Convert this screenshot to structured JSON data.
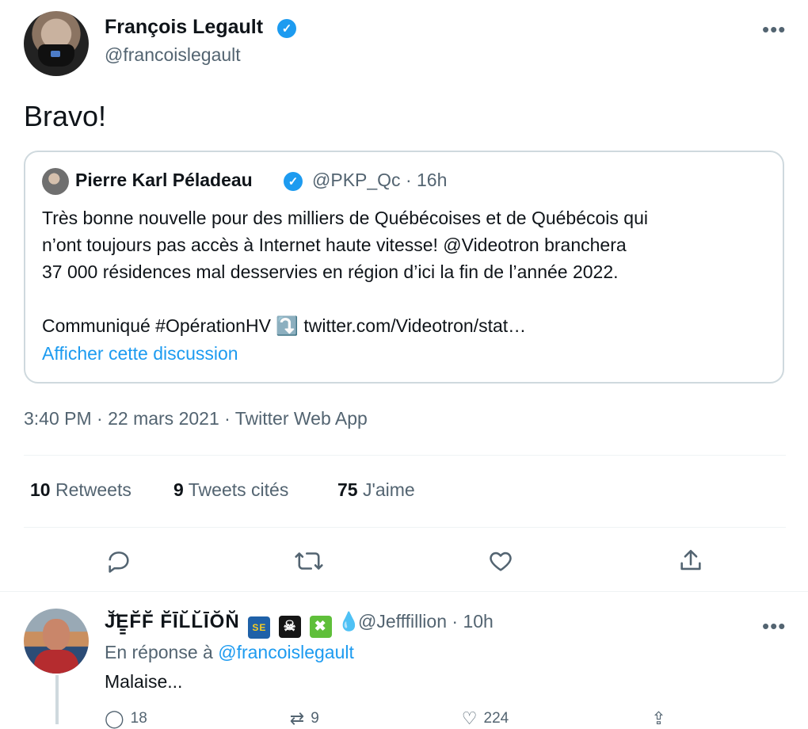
{
  "tweet": {
    "author_name": "François Legault",
    "author_handle": "@francoislegault",
    "verified_icon": "✓",
    "text": "Bravo!",
    "timestamp": "3:40 PM · 22 mars 2021 · Twitter Web App",
    "menu_icon": "•••"
  },
  "quote": {
    "author_name": "Pierre Karl Péladeau",
    "author_handle": "@PKP_Qc",
    "time": "· 16h",
    "text": "Très bonne nouvelle pour des milliers de Québécoises et de Québécois qui\nn’ont toujours pas accès à Internet haute vitesse! @Videotron branchera\n37 000 résidences mal desservies en région d’ici la fin de l’année 2022.\n\nCommuniqué #OpérationHV ⤵️ twitter.com/Videotron/stat…",
    "show_thread_label": "Afficher cette discussion"
  },
  "stats": [
    {
      "count": "10",
      "label": "Retweets"
    },
    {
      "count": "9",
      "label": "Tweets cités"
    },
    {
      "count": "75",
      "label": "J'aime"
    }
  ],
  "actions": {
    "reply_icon": "reply-icon",
    "retweet_icon": "retweet-icon",
    "like_icon": "heart-icon",
    "share_icon": "share-icon"
  },
  "reply": {
    "author_name": "J̆̆E̳F̆F̆ F̆ĪL̆L̆ĪŎN̆",
    "emoji_flag": "SE",
    "emoji_skull": "☠",
    "emoji_cross": "✖",
    "emoji_drop": "💧",
    "author_handle": "@Jefffillion",
    "time": "· 10h",
    "reply_prefix": "En réponse à",
    "reply_target": "@francoislegault",
    "text": "Malaise...",
    "counts": {
      "reply": "18",
      "retweet": "9",
      "like": "224"
    }
  }
}
